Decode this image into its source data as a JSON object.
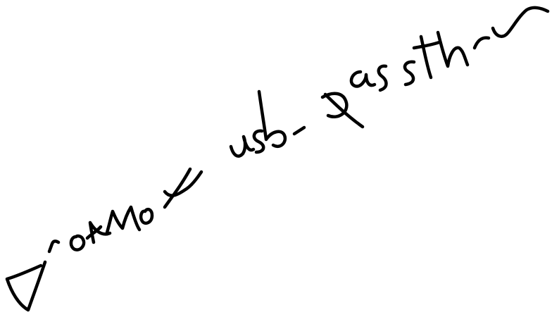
{
  "handwriting": {
    "text": "proxmox usb-passthru",
    "ink_color": "#000000",
    "background_color": "#ffffff"
  }
}
